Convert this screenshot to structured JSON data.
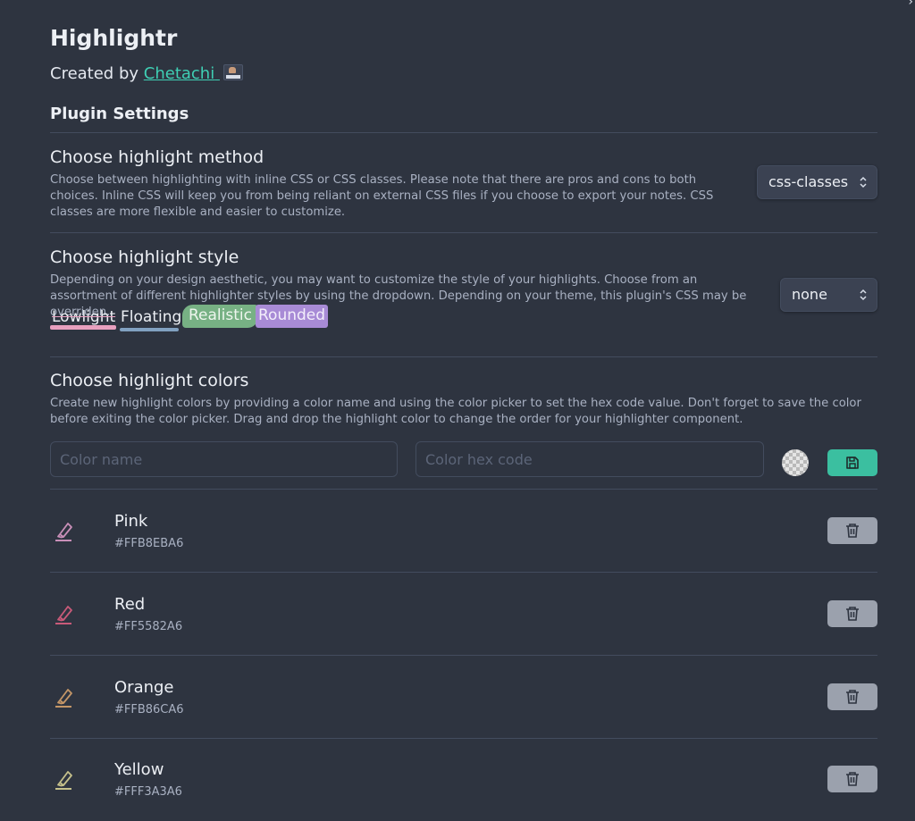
{
  "header": {
    "title": "Highlightr",
    "created_prefix": "Created by ",
    "author": "Chetachi"
  },
  "section_title": "Plugin Settings",
  "method": {
    "name": "Choose highlight method",
    "description": "Choose between highlighting with inline CSS or CSS classes. Please note that there are pros and cons to both choices. Inline CSS will keep you from being reliant on external CSS files if you choose to export your notes. CSS classes are more flexible and easier to customize.",
    "selected": "css-classes"
  },
  "style": {
    "name": "Choose highlight style",
    "description": "Depending on your design aesthetic, you may want to customize the style of your highlights. Choose from an assortment of different highlighter styles by using the dropdown. Depending on your theme, this plugin's CSS may be overriden.",
    "selected": "none",
    "samples": [
      "Lowlight",
      "Floating",
      "Realistic",
      "Rounded"
    ]
  },
  "colors": {
    "name": "Choose highlight colors",
    "description": "Create new highlight colors by providing a color name and using the color picker to set the hex code value. Don't forget to save the color before exiting the color picker. Drag and drop the highlight color to change the order for your highlighter component.",
    "name_placeholder": "Color name",
    "hex_placeholder": "Color hex code",
    "items": [
      {
        "name": "Pink",
        "hex": "#FFB8EBA6",
        "icon_color": "#c98fb8"
      },
      {
        "name": "Red",
        "hex": "#FF5582A6",
        "icon_color": "#c85a79"
      },
      {
        "name": "Orange",
        "hex": "#FFB86CA6",
        "icon_color": "#c49667"
      },
      {
        "name": "Yellow",
        "hex": "#FFF3A3A6",
        "icon_color": "#c5c08b"
      }
    ]
  },
  "theme": {
    "background": "#2e3440",
    "accent": "#3bbfa0",
    "link": "#3fcfb4",
    "delete_button": "#9ba1ad"
  }
}
